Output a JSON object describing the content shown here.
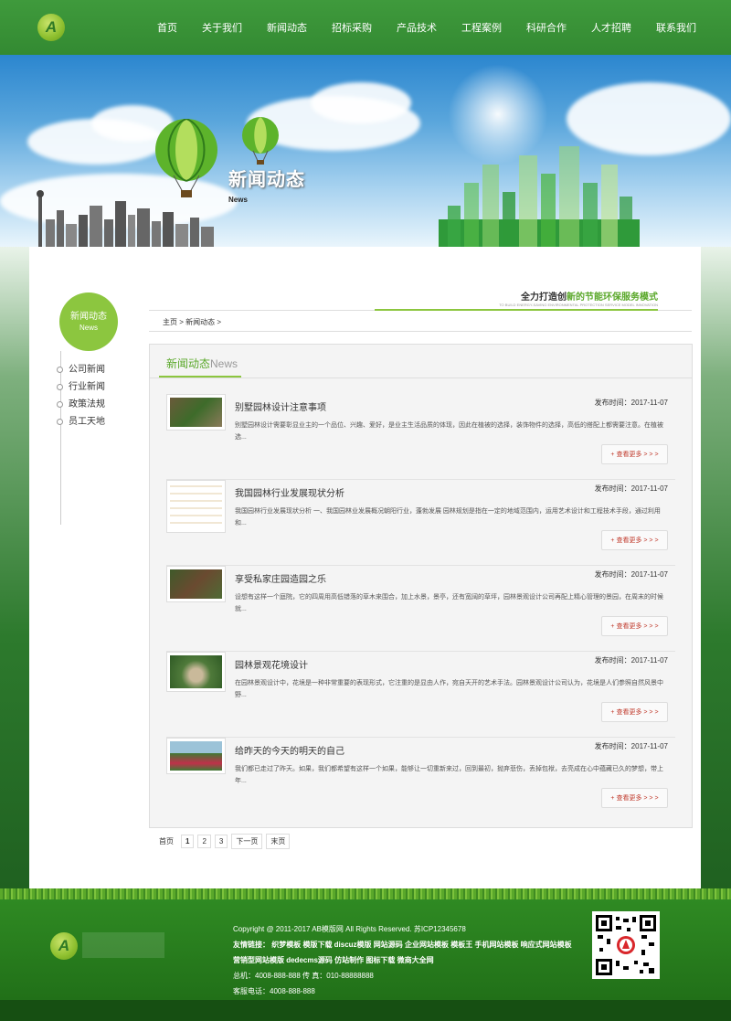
{
  "nav": {
    "items": [
      "首页",
      "关于我们",
      "新闻动态",
      "招标采购",
      "产品技术",
      "工程案例",
      "科研合作",
      "人才招聘",
      "联系我们"
    ]
  },
  "logo": {
    "letter": "A"
  },
  "banner": {
    "title": "新闻动态",
    "subtitle": "News"
  },
  "sidebar": {
    "title": "新闻动态",
    "subtitle": "News",
    "items": [
      "公司新闻",
      "行业新闻",
      "政策法规",
      "员工天地"
    ]
  },
  "slogan": {
    "prefix": "全力打造创",
    "highlight": "新的节能环保服务模式",
    "en": "TO BUILD ENERGY-SAVING ENVIRONMENTAL PROTECTION SERVICE MODEL INNOVATION"
  },
  "breadcrumb": "主页 > 新闻动态 >",
  "panel": {
    "tab_cn": "新闻动态",
    "tab_en": "News"
  },
  "news": [
    {
      "title": "别墅园林设计注意事项",
      "date": "发布时间：2017-11-07",
      "desc": "别墅园林设计需要彰显业主的一个品位、兴趣、爱好，是业主生活品质的体现，因此在植被的选择，装饰物件的选择，高低的搭配上都需要注意。在植被选...",
      "more": "+ 查看更多 > > >"
    },
    {
      "title": "我国园林行业发展现状分析",
      "date": "发布时间：2017-11-07",
      "desc": "我国园林行业发展现状分析 一、我国园林业发展概况朝阳行业，蓬勃发展 园林规划是指在一定的地域范围内，运用艺术设计和工程技术手段，通过利用和...",
      "more": "+ 查看更多 > > >"
    },
    {
      "title": "享受私家庄园造园之乐",
      "date": "发布时间：2017-11-07",
      "desc": "设想有这样一个庭院，它的四周用高低错落的草木来围合，加上水景，景亭，还有宽阔的草坪，园林景观设计公司再配上精心管理的景园，在周末的时候就...",
      "more": "+ 查看更多 > > >"
    },
    {
      "title": "园林景观花境设计",
      "date": "发布时间：2017-11-07",
      "desc": "在园林景观设计中，花境是一种非常重要的表现形式，它注重的是显由人作，宛自天开的艺术手法。园林景观设计公司认为，花境是人们参照自然风景中野...",
      "more": "+ 查看更多 > > >"
    },
    {
      "title": "给昨天的今天的明天的自己",
      "date": "发布时间：2017-11-07",
      "desc": "我们都已走过了昨天。如果，我们都希望有这样一个如果，能够让一切重新来过，回到最初，抛弃悲伤，丢掉包袱，去亮成在心中蕴藏已久的梦想，带上年...",
      "more": "+ 查看更多 > > >"
    }
  ],
  "pager": [
    "首页",
    "1",
    "2",
    "3",
    "下一页",
    "末页"
  ],
  "footer": {
    "copyright": "Copyright @ 2011-2017 AB模版网 All Rights Reserved.    苏ICP12345678",
    "links": "友情链接： 织梦模板  模版下载  discuz模版  网站源码  企业网站模板  模板王  手机网站模板  响应式网站模板  营销型网站模版  dedecms源码  仿站制作  图标下载  微商大全网",
    "phone": "总机：4008-888-888     传 真：010-88888888",
    "service": "客服电话：4008-888-888"
  },
  "colors": {
    "brand_green": "#3f9a3c",
    "accent_lime": "#8cc63f",
    "more_red": "#c0392b"
  }
}
